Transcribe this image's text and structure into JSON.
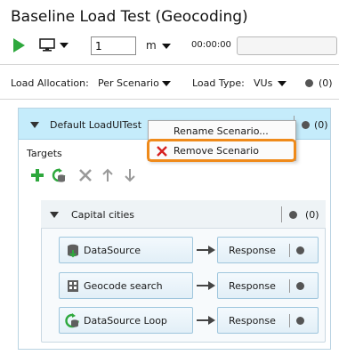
{
  "title": "Baseline Load Test (Geocoding)",
  "toolbar": {
    "run_icon": "play-icon",
    "monitor_icon": "monitor-icon",
    "limit_value": "1",
    "limit_unit": "m",
    "elapsed_time": "00:00:00",
    "progress": 0
  },
  "allocation": {
    "load_allocation_label": "Load Allocation:",
    "load_allocation_value": "Per Scenario",
    "load_type_label": "Load Type:",
    "load_type_value": "VUs",
    "count": "(0)"
  },
  "scenario": {
    "name": "Default LoadUITest",
    "count": "(0)",
    "targets_label": "Targets",
    "tools": [
      "add-icon",
      "refresh-datasource-icon",
      "delete-icon",
      "move-up-icon",
      "move-down-icon"
    ]
  },
  "context_menu": {
    "items": [
      "Rename Scenario...",
      "Remove Scenario"
    ],
    "highlight_color": "#ef8a1a"
  },
  "group": {
    "name": "Capital cities",
    "count": "(0)",
    "components": [
      {
        "label": "DataSource",
        "icon": "datasource-icon",
        "response": "Response"
      },
      {
        "label": "Geocode search",
        "icon": "geocode-icon",
        "response": "Response"
      },
      {
        "label": "DataSource Loop",
        "icon": "datasource-loop-icon",
        "response": "Response"
      }
    ]
  },
  "colors": {
    "header_bg": "#c5ecfb",
    "play_green": "#2ea83d",
    "delete_red": "#d62020"
  }
}
